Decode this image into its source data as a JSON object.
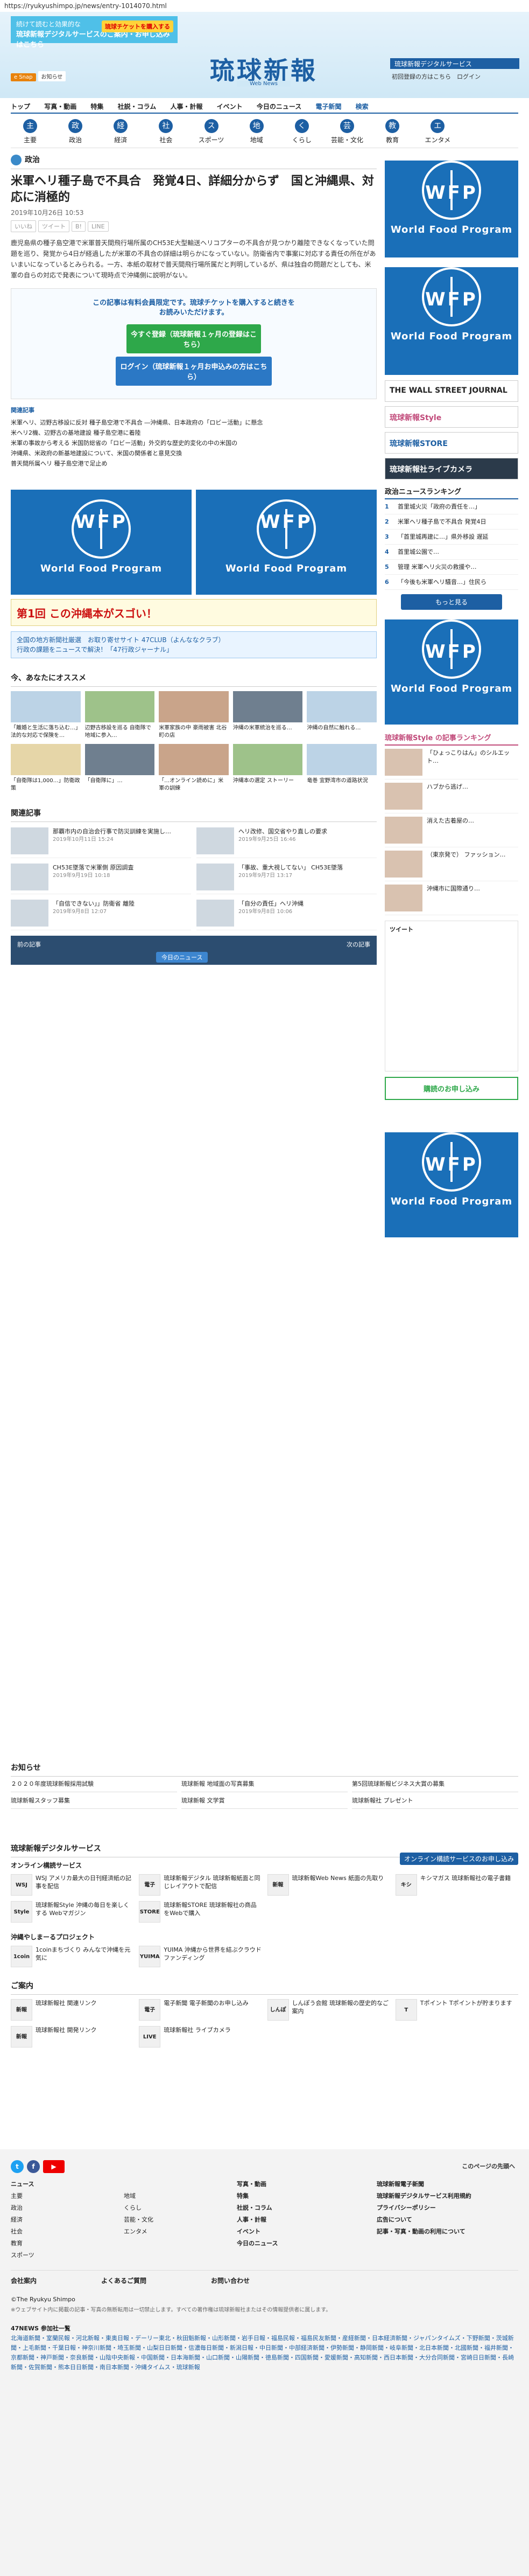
{
  "url": "https://ryukyushimpo.jp/news/entry-1014070.html",
  "topad": {
    "line1": "続けて読むと効果的な",
    "line2": "琉球新報デジタルサービスのご案内・お申し込みはこちら",
    "btn": "琉球チケットを購入する"
  },
  "logo": {
    "title": "琉球新報",
    "sub": "Web News"
  },
  "rbox": "琉球新報デジタルサービス",
  "rlinks": "初回登録の方はこちら　ログイン",
  "smalltabs": [
    "e Snap",
    "お知らせ"
  ],
  "mainnav": [
    "トップ",
    "写真・動画",
    "特集",
    "社説・コラム",
    "人事・計報",
    "イベント",
    "今日のニュース",
    "電子新聞",
    "検索"
  ],
  "iconnav": [
    {
      "icon": "主",
      "label": "主要"
    },
    {
      "icon": "政",
      "label": "政治"
    },
    {
      "icon": "経",
      "label": "経済"
    },
    {
      "icon": "社",
      "label": "社会"
    },
    {
      "icon": "ス",
      "label": "スポーツ"
    },
    {
      "icon": "地",
      "label": "地域"
    },
    {
      "icon": "く",
      "label": "くらし"
    },
    {
      "icon": "芸",
      "label": "芸能・文化"
    },
    {
      "icon": "教",
      "label": "教育"
    },
    {
      "icon": "エ",
      "label": "エンタメ"
    }
  ],
  "article": {
    "section": "政治",
    "headline": "米軍ヘリ種子島で不具合　発覚4日、詳細分からず　国と沖縄県、対応に消極的",
    "date": "2019年10月26日 10:53",
    "share": [
      "いいね",
      "ツイート",
      "B!",
      "LINE"
    ],
    "lead": "鹿児島県の種子島空港で米軍普天間飛行場所属のCH53E大型輸送ヘリコプターの不具合が見つかり離陸できなくなっていた問題を巡り、発覚から4日が経過したが米軍の不具合の詳細は明らかになっていない。防衛省内で事案に対応する責任の所在があいまいになっているとみられる。一方、本紙の取材で普天間飛行場所属だと判明しているが、県は独自の問題だとしても、米軍の自らの対応で発表について現時点で沖縄側に説明がない。"
  },
  "paywall": {
    "msg1": "この記事は有料会員限定です。琉球チケットを購入すると続きを",
    "msg2": "お読みいただけます。",
    "buy": "今すぐ登録（琉球新報１ヶ月の登録はこちら）",
    "login": "ログイン（琉球新報１ヶ月お申込みの方はこちら）"
  },
  "related": {
    "title": "関連記事",
    "items": [
      "米軍ヘリ、辺野古移設に反対 種子島空港で不具合 ―沖縄県、日本政府の「ロビー活動」に懸念",
      "米ヘリ2機、辺野古の基地建設 種子島空港に着陸",
      "米軍の事故から考える 米国防総省の「ロビー活動」外交的な歴史的変化の中の米国の",
      "沖縄県、米政府の新基地建設について、米国の関係者と意見交換",
      "普天間所属ヘリ 種子島空港で足止め"
    ]
  },
  "wfp": {
    "title": "World Food Program",
    "w": "WFP"
  },
  "okinawa": {
    "badge": "第1回",
    "text": "この沖縄本がスゴい！"
  },
  "promo": {
    "l1": "全国の地方新聞社厳選　お取り寄せサイト 47CLUB（よんななクラブ）",
    "l2": "行政の課題をニュースで解決！「47行政ジャーナル」"
  },
  "recommend": {
    "title": "今、あなたにオススメ",
    "cards": [
      "「離婚と生活に落ち込む…」法的な対応で保険を…",
      "辺野古移設を巡る 自衛隊で地域に参入…",
      "米軍家族の中 豪雨被害 北谷町の店",
      "沖縄の米軍統治を巡る…",
      "沖縄の自然に触れる…",
      "「自衛隊は1,000…」防衛政策",
      "「自衛隊に」…",
      "「…オンライン読めに」米軍の訓練",
      "沖縄本の選定 ストーリー",
      "竜巻 宜野湾市の道路状況"
    ]
  },
  "entries": [
    {
      "text": "那覇市内の自治会行事で防災訓練を実施し…",
      "date": "2019年10月11日 15:24"
    },
    {
      "text": "ヘリ改修、国交省やり直しの要求",
      "date": "2019年9月25日 16:46"
    },
    {
      "text": "CH53E墜落で米軍側 原因調査",
      "date": "2019年9月19日 10:18"
    },
    {
      "text": "「事故、重大視してない」 CH53E墜落",
      "date": "2019年9月7日 13:17"
    },
    {
      "text": "「自信できない」」防衛省 離陸",
      "date": "2019年9月8日 12:07"
    },
    {
      "text": "「自分の責任」ヘリ沖縄",
      "date": "2019年9月8日 10:06"
    }
  ],
  "pager": {
    "prev": "前の記事",
    "next": "次の記事",
    "today": "今日のニュース"
  },
  "side": {
    "banners": [
      "THE WALL STREET JOURNAL",
      "琉球新報Style",
      "琉球新報STORE",
      "琉球新報社ライブカメラ"
    ],
    "rankTitle": "政治ニュースランキング",
    "rank": [
      "首里城火災「政府の責任を…」",
      "米軍ヘリ種子島で不具合 発覚4日",
      "「首里城再建に…」県外移設 遅延",
      "首里城公園で…",
      "管理 米軍ヘリ火災の救援や…",
      "「今後も米軍ヘリ騒音…」住民ら"
    ],
    "more": "もっと見る",
    "styleTitle": "琉球新報Style の記事ランキング",
    "style": [
      "「ひょっこりはん」のシルエット…",
      "ハブから逃げ…",
      "消えた古着屋の…",
      "（東京発で） ファッション…",
      "沖縄市に国際通り…"
    ],
    "twitterTitle": "ツイート",
    "cta": "購読のお申し込み"
  },
  "notice": {
    "title": "お知らせ",
    "items": [
      "２０２０年度琉球新報採用試験",
      "琉球新報 地域面の写真募集",
      "第5回琉球新報ビジネス大賞の募集",
      "琉球新報スタッフ募集",
      "琉球新報 文学賞",
      "琉球新報社 プレゼント"
    ]
  },
  "digi": {
    "title": "琉球新報デジタルサービス",
    "sub": "オンライン構読サービス",
    "btn": "オンライン構読サービスのお申し込み",
    "items": [
      {
        "lg": "WSJ",
        "t": "WSJ アメリカ最大の日刊経済紙の記事を配信"
      },
      {
        "lg": "電子",
        "t": "琉球新報デジタル 琉球新報紙面と同じレイアウトで配信"
      },
      {
        "lg": "新報",
        "t": "琉球新報Web News 紙面の先取り"
      },
      {
        "lg": "キシ",
        "t": "キシマガス 琉球新報社の電子書籍"
      },
      {
        "lg": "Style",
        "t": "琉球新報Style 沖縄の毎日を楽しくする Webマガジン"
      },
      {
        "lg": "STORE",
        "t": "琉球新報STORE 琉球新報社の商品をWebで購入"
      }
    ]
  },
  "go": {
    "title": "沖縄やしまーるプロジェクト",
    "items": [
      {
        "lg": "1coin",
        "t": "1coinまちづくり みんなで沖縄を元気に"
      },
      {
        "lg": "YUIMA",
        "t": "YUIMA 沖縄から世界を結ぶクラウドファンディング"
      }
    ]
  },
  "guide": {
    "title": "ご案内",
    "items": [
      {
        "lg": "新報",
        "t": "琉球新報社 関連リンク"
      },
      {
        "lg": "電子",
        "t": "電子新聞 電子新聞のお申し込み"
      },
      {
        "lg": "しんぽ",
        "t": "しんぽう会館 琉球新報の歴史的なご案内"
      },
      {
        "lg": "T",
        "t": "Tポイント Tポイントが貯まります"
      },
      {
        "lg": "新報",
        "t": "琉球新報社 開発リンク"
      },
      {
        "lg": "LIVE",
        "t": "琉球新報社 ライブカメラ"
      }
    ]
  },
  "footer": {
    "contact": "このページの先頭へ",
    "news": "ニュース",
    "cats": [
      "主要",
      "政治",
      "経済",
      "社会",
      "教育",
      "スポーツ",
      "地域",
      "くらし",
      "芸能・文化",
      "エンタメ"
    ],
    "col2": [
      "写真・動画",
      "特集",
      "社説・コラム",
      "人事・計報",
      "イベント",
      "今日のニュース"
    ],
    "col3": [
      "琉球新報電子新聞",
      "琉球新報デジタルサービス利用規約",
      "プライバシーポリシー",
      "広告について",
      "記事・写真・動画の利用について"
    ],
    "company": "会社案内",
    "faq": "よくあるご質問",
    "contact2": "お問い合わせ",
    "copy": "©The Ryukyu Shimpo",
    "note": "※ウェブサイト内に掲載の記事・写真の無断転用は一切禁止します。すべての著作権は琉球新報社またはその情報提供者に属します。",
    "pressTitle": "47NEWS 参加社一覧",
    "press": "北海道新聞・室蘭民報・河北新報・東奥日報・デーリー東北・秋田魁新報・山形新聞・岩手日報・福島民報・福島民友新聞・産経新聞・日本経済新聞・ジャパンタイムズ・下野新聞・茨城新聞・上毛新聞・千葉日報・神奈川新聞・埼玉新聞・山梨日日新聞・信濃毎日新聞・新潟日報・中日新聞・中部経済新聞・伊勢新聞・静岡新聞・岐阜新聞・北日本新聞・北國新聞・福井新聞・京都新聞・神戸新聞・奈良新聞・山陰中央新報・中国新聞・日本海新聞・山口新聞・山陽新聞・徳島新聞・四国新聞・愛媛新聞・高知新聞・西日本新聞・大分合同新聞・宮崎日日新聞・長崎新聞・佐賀新聞・熊本日日新聞・南日本新聞・沖縄タイムス・琉球新報"
  }
}
